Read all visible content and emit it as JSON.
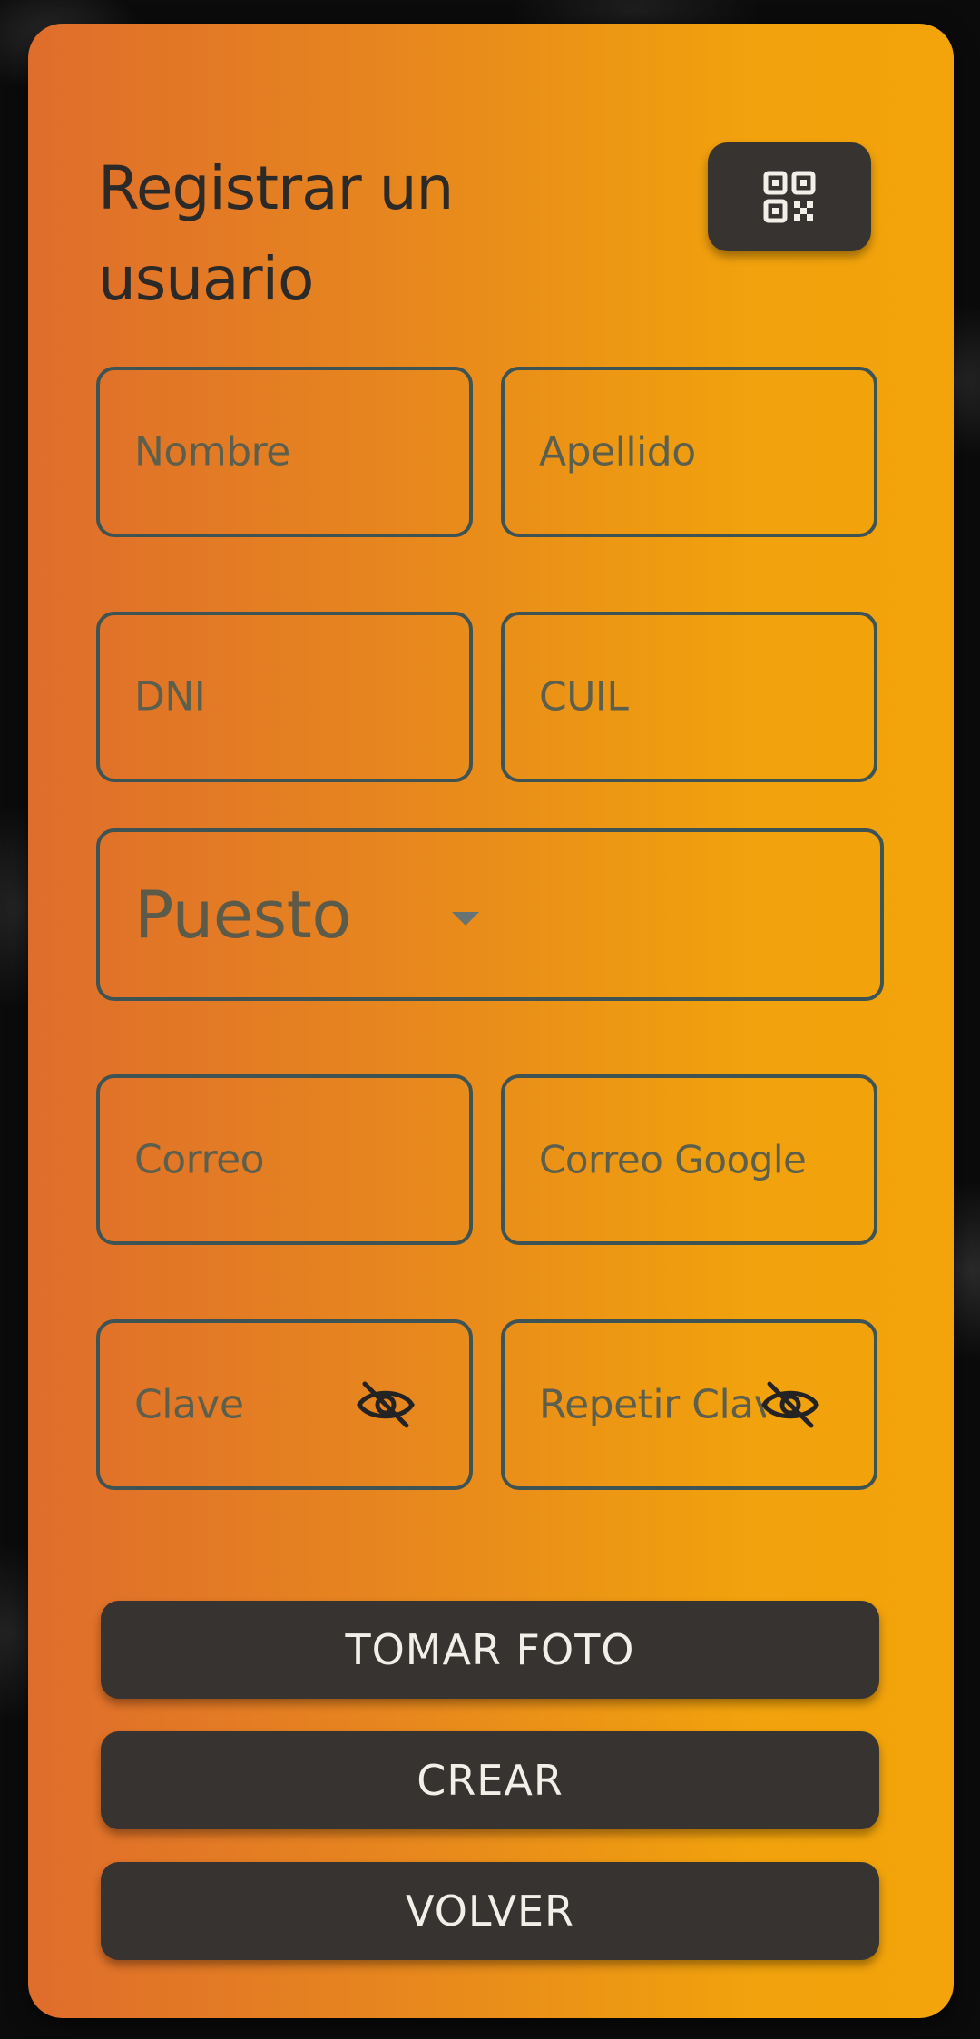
{
  "form": {
    "title": "Registrar un usuario",
    "qr_icon": "qr-code-icon"
  },
  "fields": {
    "nombre": {
      "placeholder": "Nombre"
    },
    "apellido": {
      "placeholder": "Apellido"
    },
    "dni": {
      "placeholder": "DNI"
    },
    "cuil": {
      "placeholder": "CUIL"
    },
    "puesto": {
      "placeholder": "Puesto",
      "icon": "dropdown-caret-icon"
    },
    "correo": {
      "placeholder": "Correo"
    },
    "correo_google": {
      "placeholder": "Correo Google"
    },
    "clave": {
      "placeholder": "Clave",
      "icon": "eye-off-icon"
    },
    "repetir_clave": {
      "placeholder": "Repetir Clave",
      "icon": "eye-off-icon"
    }
  },
  "buttons": {
    "tomar_foto": "TOMAR FOTO",
    "crear": "CREAR",
    "volver": "VOLVER"
  },
  "colors": {
    "card_gradient_start": "#df6d2c",
    "card_gradient_end": "#f3a40a",
    "button_bg": "#363330",
    "field_border": "#3e5354",
    "title_text": "#2b2a28"
  }
}
